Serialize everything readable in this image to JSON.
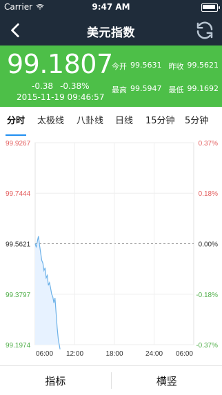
{
  "status_bar": {
    "carrier": "Carrier",
    "time": "9:47 AM"
  },
  "nav": {
    "title": "美元指数"
  },
  "quote": {
    "price": "99.1807",
    "change": "-0.38",
    "change_pct": "-0.38%",
    "datetime": "2015-11-19 09:46:57",
    "today_open_label": "今开",
    "today_open_value": "99.5631",
    "yesterday_close_label": "昨收",
    "yesterday_close_value": "99.5621",
    "high_label": "最高",
    "high_value": "99.5947",
    "low_label": "最低",
    "low_value": "99.1692"
  },
  "tabs": {
    "items": [
      "分时",
      "太极线",
      "八卦线",
      "日线",
      "15分钟",
      "5分钟"
    ],
    "active": 0
  },
  "chart_data": {
    "type": "area",
    "x_range": [
      "06:00",
      "06:00"
    ],
    "x_ticks": [
      "06:00",
      "12:00",
      "18:00",
      "24:00",
      "06:00"
    ],
    "y_ticks": [
      "99.9267",
      "99.7444",
      "99.5621",
      "99.3797",
      "99.1974"
    ],
    "y_right_ticks": [
      "0.37%",
      "0.18%",
      "0.00%",
      "-0.18%",
      "-0.37%"
    ],
    "ylim": [
      99.1974,
      99.9267
    ],
    "baseline": 99.5621,
    "series": [
      {
        "values": [
          [
            "06:00",
            99.5621
          ],
          [
            "06:10",
            99.5487
          ],
          [
            "06:20",
            99.5713
          ],
          [
            "06:30",
            99.589
          ],
          [
            "06:40",
            99.5565
          ],
          [
            "06:50",
            99.5287
          ],
          [
            "07:00",
            99.5017
          ],
          [
            "07:10",
            99.492
          ],
          [
            "07:20",
            99.4652
          ],
          [
            "07:30",
            99.4748
          ],
          [
            "07:40",
            99.4386
          ],
          [
            "07:50",
            99.4476
          ],
          [
            "08:00",
            99.4116
          ],
          [
            "08:10",
            99.4214
          ],
          [
            "08:20",
            99.4024
          ],
          [
            "08:30",
            99.3796
          ],
          [
            "08:40",
            99.3707
          ],
          [
            "08:50",
            99.3484
          ],
          [
            "09:00",
            99.3664
          ],
          [
            "09:10",
            99.3121
          ],
          [
            "09:20",
            99.2578
          ],
          [
            "09:30",
            99.2173
          ],
          [
            "09:46",
            99.1807
          ]
        ]
      }
    ]
  },
  "bottom": {
    "left_label": "指标",
    "right_label": "横竖"
  },
  "colors": {
    "nav_bg": "#1f2c3a",
    "quote_bg": "#4dbf48",
    "line": "#6cb1e8",
    "fill": "#e7f2ff",
    "up": "#e35d5d",
    "down": "#4fae48",
    "neutral": "#333333"
  },
  "icons": {
    "back": "chevron-left-icon",
    "refresh": "refresh-icon",
    "wifi": "wifi-icon",
    "battery": "battery-icon"
  }
}
